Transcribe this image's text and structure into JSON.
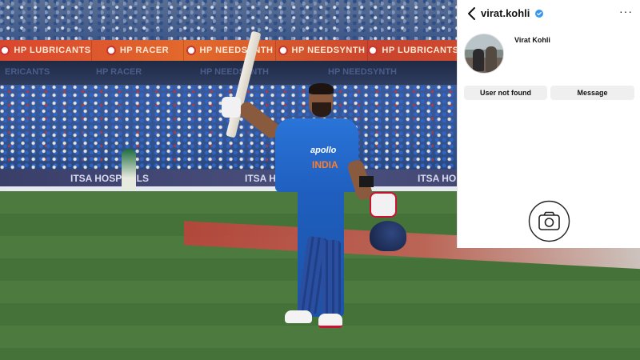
{
  "photo": {
    "ad_boards": [
      "HP LUBRICANTS",
      "HP RACER",
      "HP NEEDSYNTH",
      "HP NEEDSYNTH",
      "HP LUBRICANTS"
    ],
    "dim_ads": [
      "ERICANTS",
      "HP RACER",
      "HP NEEDSYNTH",
      "HP NEEDSYNTH"
    ],
    "boundary_ads": [
      "ITSA HOSPITALS",
      "ITSA HOS",
      "ITSA HO"
    ],
    "jersey_sponsor": "apollo",
    "jersey_team": "INDIA"
  },
  "profile": {
    "username": "virat.kohli",
    "full_name": "Virat Kohli",
    "status_button": "User not found",
    "message_button": "Message",
    "icons": {
      "back": "chevron-left-icon",
      "verified": "verified-badge-icon",
      "more": "more-options-icon",
      "camera": "camera-icon"
    },
    "colors": {
      "verified": "#3897f0",
      "button_bg": "#efefef"
    }
  }
}
